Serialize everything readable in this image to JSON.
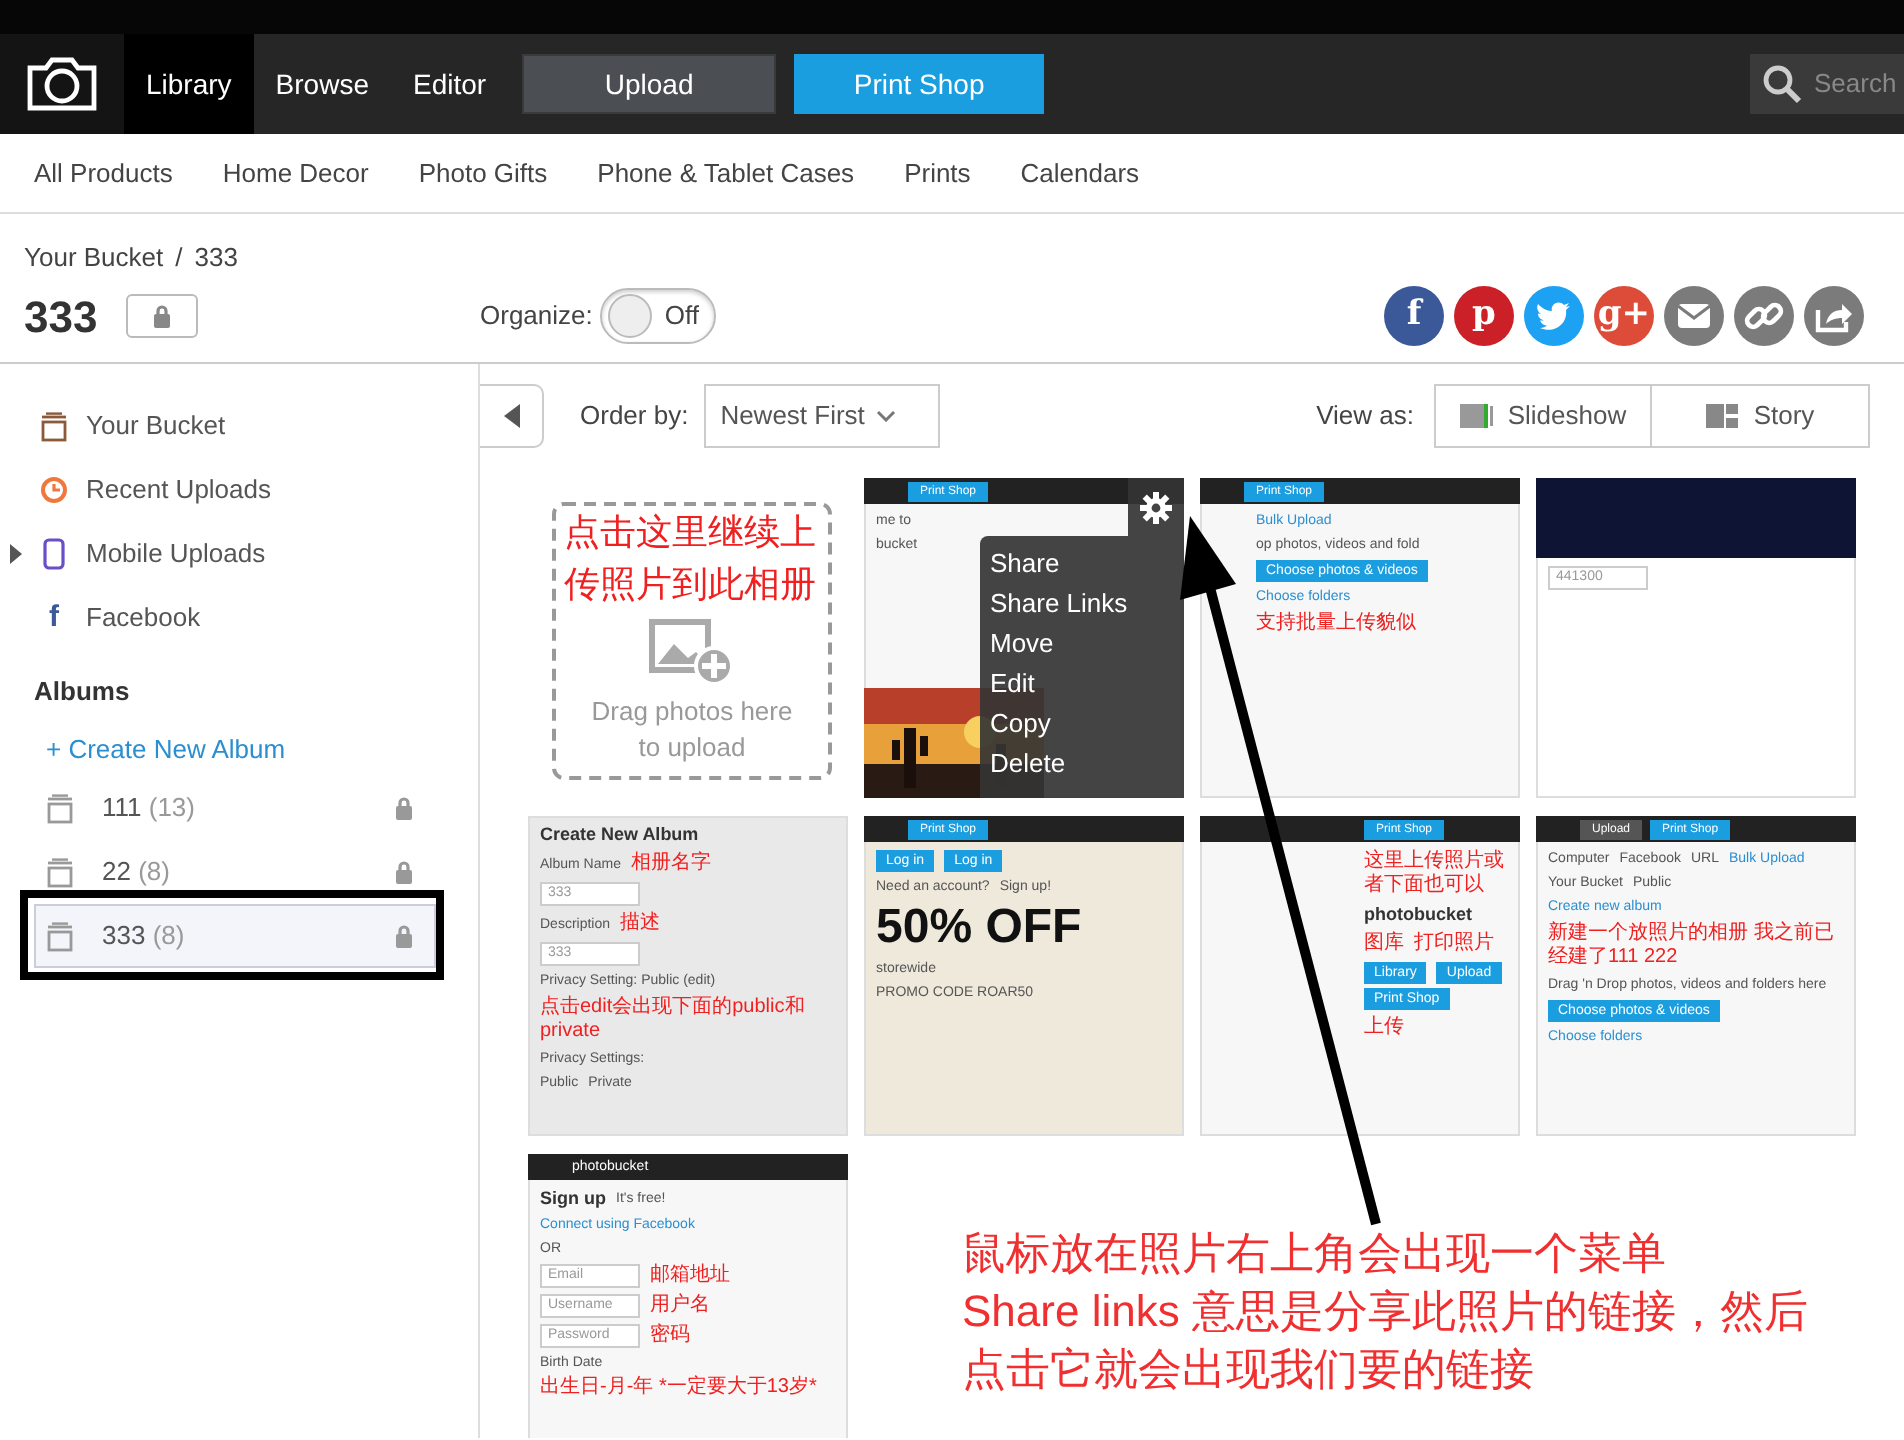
{
  "top_nav": {
    "tabs": [
      {
        "label": "Library",
        "selected": true
      },
      {
        "label": "Browse",
        "selected": false
      },
      {
        "label": "Editor",
        "selected": false
      }
    ],
    "upload_button": "Upload",
    "print_shop_button": "Print Shop",
    "search": {
      "placeholder": "Search"
    }
  },
  "product_nav": [
    "All Products",
    "Home Decor",
    "Photo Gifts",
    "Phone & Tablet Cases",
    "Prints",
    "Calendars"
  ],
  "breadcrumb": {
    "link": "Your Bucket",
    "separator": "/",
    "current": "333"
  },
  "album": {
    "title": "333",
    "locked": true
  },
  "organize": {
    "label": "Organize:",
    "on": false,
    "state_text": "Off"
  },
  "share_buttons": [
    {
      "kind": "facebook",
      "glyph": "f",
      "color": "#3b5998"
    },
    {
      "kind": "pinterest",
      "glyph": "p",
      "color": "#cb2027"
    },
    {
      "kind": "twitter",
      "color": "#1da1f2"
    },
    {
      "kind": "google",
      "glyph": "g+",
      "color": "#dd4b39"
    },
    {
      "kind": "email",
      "color": "#7b7b7b"
    },
    {
      "kind": "link",
      "color": "#7b7b7b"
    },
    {
      "kind": "share",
      "color": "#7b7b7b"
    }
  ],
  "sidebar": {
    "items": [
      {
        "kind": "bucket",
        "label": "Your Bucket"
      },
      {
        "kind": "recent",
        "label": "Recent Uploads"
      },
      {
        "kind": "mobile",
        "label": "Mobile Uploads",
        "expanded": false
      },
      {
        "kind": "facebook",
        "glyph": "f",
        "label": "Facebook"
      }
    ],
    "albums_heading": "Albums",
    "create_album": "+ Create New Album",
    "albums": [
      {
        "name": "111",
        "count": "(13)",
        "locked": true,
        "selected": false,
        "framed": false
      },
      {
        "name": "22",
        "count": "(8)",
        "locked": true,
        "selected": false,
        "framed": false
      },
      {
        "name": "333",
        "count": "(8)",
        "locked": true,
        "selected": true,
        "framed": true
      }
    ]
  },
  "toolbar": {
    "order_label": "Order by:",
    "order_value": "Newest First",
    "view_label": "View as:",
    "view_buttons": [
      {
        "kind": "slideshow",
        "label": "Slideshow"
      },
      {
        "kind": "story",
        "label": "Story"
      }
    ]
  },
  "tiles": [
    {
      "kind": "upload",
      "note": "点击这里继续上传照片到此相册",
      "hint": "Drag photos here to upload"
    },
    {
      "kind": "screenshot",
      "header": [
        {
          "kind": "button",
          "text": "Print Shop"
        }
      ],
      "lines": [
        [
          {
            "kind": "plain",
            "text": "me to"
          }
        ],
        [
          {
            "kind": "plain",
            "text": "bucket"
          }
        ]
      ],
      "menu": [
        "Share",
        "Share Links",
        "Move",
        "Edit",
        "Copy",
        "Delete"
      ]
    },
    {
      "kind": "screenshot",
      "header": [
        {
          "kind": "button",
          "text": "Print Shop"
        }
      ],
      "lines": [
        [
          {
            "kind": "link",
            "text": "Bulk Upload"
          }
        ],
        [
          {
            "kind": "plain",
            "text": "op photos, videos and fold"
          }
        ],
        [
          {
            "kind": "button",
            "text": "Choose photos & videos"
          }
        ],
        [
          {
            "kind": "link",
            "text": "Choose folders"
          }
        ],
        [
          {
            "kind": "red",
            "text": "支持批量上传貌似"
          }
        ]
      ]
    },
    {
      "kind": "screenshot",
      "lines": [
        [
          {
            "kind": "field",
            "text": "441300"
          }
        ]
      ]
    },
    {
      "kind": "screenshot",
      "lines": [
        [
          {
            "kind": "title",
            "text": "Create New Album"
          }
        ],
        [
          {
            "kind": "plain",
            "text": "Album Name"
          },
          {
            "kind": "red",
            "text": "相册名字"
          }
        ],
        [
          {
            "kind": "field",
            "text": "333"
          }
        ],
        [
          {
            "kind": "plain",
            "text": "Description"
          },
          {
            "kind": "red",
            "text": "描述"
          }
        ],
        [
          {
            "kind": "field",
            "text": "333"
          }
        ],
        [
          {
            "kind": "plain",
            "text": "Privacy Setting: Public (edit)"
          }
        ],
        [
          {
            "kind": "red",
            "text": "点击edit会出现下面的public和private"
          }
        ],
        [
          {
            "kind": "plain",
            "text": "Privacy Settings:"
          }
        ],
        [
          {
            "kind": "plain",
            "text": "Public"
          },
          {
            "kind": "plain",
            "text": "Private"
          }
        ]
      ]
    },
    {
      "kind": "screenshot",
      "header": [
        {
          "kind": "button",
          "text": "Print Shop"
        }
      ],
      "lines": [
        [
          {
            "kind": "button",
            "text": "Log in"
          },
          {
            "kind": "button",
            "text": "Log in"
          }
        ],
        [
          {
            "kind": "plain",
            "text": "Need an account?"
          },
          {
            "kind": "plain",
            "text": "Sign up!"
          }
        ],
        [
          {
            "kind": "big",
            "text": "50% OFF"
          }
        ],
        [
          {
            "kind": "plain",
            "text": "storewide"
          }
        ],
        [
          {
            "kind": "plain",
            "text": "PROMO CODE ROAR50"
          }
        ]
      ]
    },
    {
      "kind": "screenshot",
      "header": [
        {
          "kind": "button",
          "text": "Print Shop"
        }
      ],
      "lines": [
        [
          {
            "kind": "red",
            "text": "这里上传照片或者下面也可以"
          }
        ],
        [
          {
            "kind": "title",
            "text": "photobucket"
          }
        ],
        [
          {
            "kind": "red",
            "text": "图库"
          },
          {
            "kind": "red",
            "text": "打印照片"
          }
        ],
        [
          {
            "kind": "button",
            "text": "Library"
          },
          {
            "kind": "button",
            "text": "Upload"
          },
          {
            "kind": "button",
            "text": "Print Shop"
          }
        ],
        [
          {
            "kind": "red",
            "text": "上传"
          }
        ]
      ]
    },
    {
      "kind": "screenshot",
      "header": [
        {
          "kind": "dark-button",
          "text": "Upload"
        },
        {
          "kind": "button",
          "text": "Print Shop"
        }
      ],
      "lines": [
        [
          {
            "kind": "plain",
            "text": "Computer"
          },
          {
            "kind": "plain",
            "text": "Facebook"
          },
          {
            "kind": "plain",
            "text": "URL"
          },
          {
            "kind": "link",
            "text": "Bulk Upload"
          }
        ],
        [
          {
            "kind": "plain",
            "text": "Your Bucket"
          },
          {
            "kind": "plain",
            "text": "Public"
          }
        ],
        [
          {
            "kind": "link",
            "text": "Create new album"
          }
        ],
        [
          {
            "kind": "red",
            "text": "新建一个放照片的相册 我之前已经建了111 222"
          }
        ],
        [
          {
            "kind": "plain",
            "text": "Drag 'n Drop photos, videos and folders here"
          }
        ],
        [
          {
            "kind": "button",
            "text": "Choose photos & videos"
          }
        ],
        [
          {
            "kind": "link",
            "text": "Choose folders"
          }
        ]
      ]
    },
    {
      "kind": "screenshot",
      "header": [
        {
          "kind": "logo",
          "text": "photobucket"
        }
      ],
      "lines": [
        [
          {
            "kind": "title",
            "text": "Sign up"
          },
          {
            "kind": "plain",
            "text": "It's free!"
          }
        ],
        [
          {
            "kind": "link",
            "text": "Connect using Facebook"
          }
        ],
        [
          {
            "kind": "plain",
            "text": "OR"
          }
        ],
        [
          {
            "kind": "field",
            "text": "Email"
          },
          {
            "kind": "red",
            "text": "邮箱地址"
          }
        ],
        [
          {
            "kind": "field",
            "text": "Username"
          },
          {
            "kind": "red",
            "text": "用户名"
          }
        ],
        [
          {
            "kind": "field",
            "text": "Password"
          },
          {
            "kind": "red",
            "text": "密码"
          }
        ],
        [
          {
            "kind": "plain",
            "text": "Birth Date"
          },
          {
            "kind": "red",
            "text": "出生日-月-年 *一定要大于13岁*"
          }
        ]
      ]
    }
  ],
  "annotation": {
    "lines": [
      "鼠标放在照片右上角会出现一个菜单",
      "Share links 意思是分享此照片的链接，然后",
      "点击它就会出现我们要的链接"
    ]
  }
}
